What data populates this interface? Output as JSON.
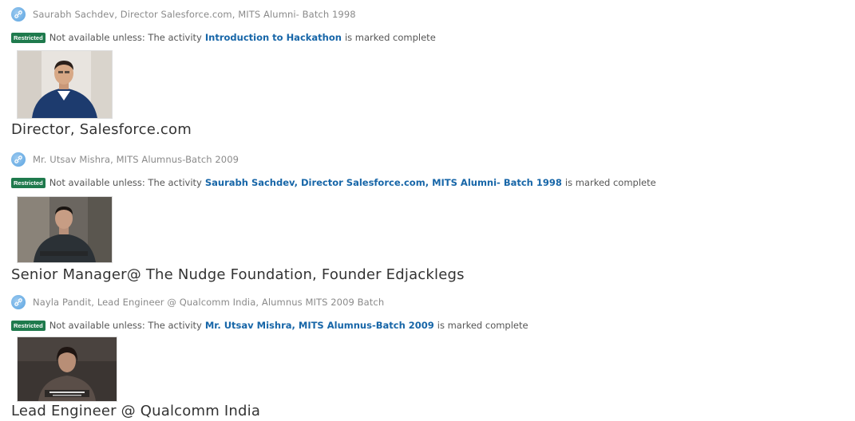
{
  "items": [
    {
      "activity_name": "Saurabh Sachdev, Director Salesforce.com, MITS Alumni- Batch 1998",
      "restriction": {
        "badge": "Restricted",
        "prefix": "Not available unless: The activity",
        "link": "Introduction to Hackathon",
        "suffix": "is marked complete"
      },
      "video_icon": "video-thumbnail",
      "caption": "Director, Salesforce.com"
    },
    {
      "activity_name": "Mr. Utsav Mishra, MITS Alumnus-Batch 2009",
      "restriction": {
        "badge": "Restricted",
        "prefix": "Not available unless: The activity",
        "link": "Saurabh Sachdev, Director Salesforce.com, MITS Alumni- Batch 1998",
        "suffix": "is marked complete"
      },
      "video_icon": "video-thumbnail",
      "caption": "Senior Manager@ The Nudge Foundation, Founder Edjacklegs"
    },
    {
      "activity_name": "Nayla Pandit, Lead Engineer @ Qualcomm India, Alumnus MITS 2009 Batch",
      "restriction": {
        "badge": "Restricted",
        "prefix": "Not available unless: The activity",
        "link": "Mr. Utsav Mishra, MITS Alumnus-Batch 2009",
        "suffix": "is marked complete"
      },
      "video_icon": "video-thumbnail",
      "caption": "Lead Engineer @ Qualcomm India"
    }
  ],
  "icons": {
    "activity": "link-icon"
  },
  "colors": {
    "badge": "#1f7a4d",
    "link": "#1766a8"
  }
}
